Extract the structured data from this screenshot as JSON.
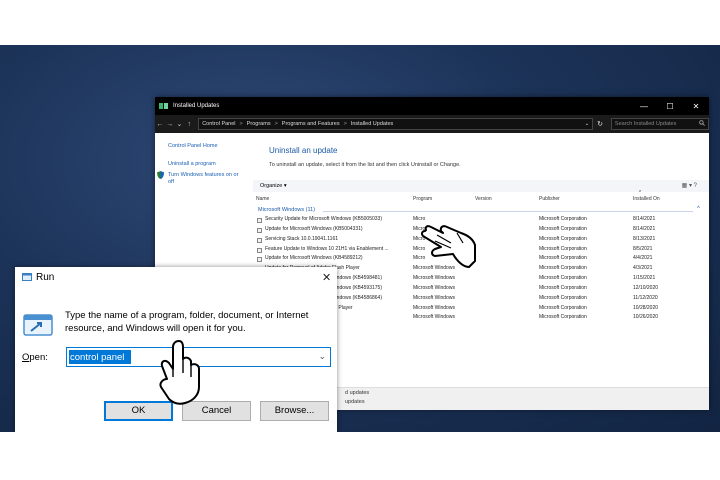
{
  "installed_updates": {
    "title": "Installed Updates",
    "controls": {
      "minimize": "—",
      "maximize": "☐",
      "close": "✕"
    },
    "address": {
      "back": "←",
      "forward": "→",
      "dropdown": "⌄",
      "up": "↑",
      "breadcrumb": [
        "Control Panel",
        "Programs",
        "Programs and Features",
        "Installed Updates"
      ],
      "separator": ">",
      "refresh": "↻"
    },
    "search": {
      "placeholder": "Search Installed Updates",
      "icon": "search-icon"
    },
    "left_pane": {
      "home_link": "Control Panel Home",
      "uninstall_link": "Uninstall a program",
      "features_link_line1": "Turn Windows features on or",
      "features_link_line2": "off"
    },
    "heading": "Uninstall an update",
    "description": "To uninstall an update, select it from the list and then click Uninstall or Change.",
    "toolbar": {
      "organize": "Organize ▾",
      "view_icons": "▦ ▾  ?"
    },
    "columns": [
      "Name",
      "Program",
      "Version",
      "Publisher",
      "Installed On"
    ],
    "sort_arrow": "^",
    "group": {
      "label": "Microsoft Windows (11)",
      "chevron": "^"
    },
    "rows": [
      {
        "name": "Security Update for Microsoft Windows (KB5005033)",
        "program": "Micro",
        "version": "",
        "publisher": "Microsoft Corporation",
        "installed": "8/14/2021"
      },
      {
        "name": "Update for Microsoft Windows (KB5004331)",
        "program": "Micro",
        "version": "",
        "publisher": "Microsoft Corporation",
        "installed": "8/14/2021"
      },
      {
        "name": "Servicing Stack 10.0.19041.1161",
        "program": "Micro",
        "version": "",
        "publisher": "Microsoft Corporation",
        "installed": "8/13/2021"
      },
      {
        "name": "Feature Update to Windows 10 21H1 via Enablement ...",
        "program": "Micro",
        "version": "",
        "publisher": "Microsoft Corporation",
        "installed": "8/5/2021"
      },
      {
        "name": "Update for Microsoft Windows (KB4589212)",
        "program": "Micro",
        "version": "",
        "publisher": "Microsoft Corporation",
        "installed": "4/4/2021"
      },
      {
        "name": "Update for Removal of Adobe Flash Player",
        "program": "Microsoft Windows",
        "version": "",
        "publisher": "Microsoft Corporation",
        "installed": "4/3/2021"
      },
      {
        "name": "Security Update for Microsoft Windows (KB4598481)",
        "program": "Microsoft Windows",
        "version": "",
        "publisher": "Microsoft Corporation",
        "installed": "1/15/2021"
      },
      {
        "name": "Security Update for Microsoft Windows (KB4593175)",
        "program": "Microsoft Windows",
        "version": "",
        "publisher": "Microsoft Corporation",
        "installed": "12/10/2020"
      },
      {
        "name": "Security Update for Microsoft Windows (KB4586864)",
        "program": "Microsoft Windows",
        "version": "",
        "publisher": "Microsoft Corporation",
        "installed": "11/12/2020"
      },
      {
        "name": "Security Update for Adobe Flash Player",
        "program": "Microsoft Windows",
        "version": "",
        "publisher": "Microsoft Corporation",
        "installed": "10/28/2020"
      },
      {
        "name": "t Windows (KB4577266)",
        "program": "Microsoft Windows",
        "version": "",
        "publisher": "Microsoft Corporation",
        "installed": "10/26/2020"
      }
    ],
    "status": {
      "line1": "d updates",
      "line2": "updates"
    }
  },
  "run_dialog": {
    "title": "Run",
    "close": "✕",
    "message": "Type the name of a program, folder, document, or Internet resource, and Windows will open it for you.",
    "open_label_underlined": "O",
    "open_label_rest": "pen:",
    "input_value": "control panel",
    "dropdown": "⌄",
    "ok": "OK",
    "cancel": "Cancel",
    "browse": "Browse..."
  },
  "colors": {
    "desktop": "#1c3358",
    "accent": "#0078d7",
    "link": "#1a5fb4"
  }
}
